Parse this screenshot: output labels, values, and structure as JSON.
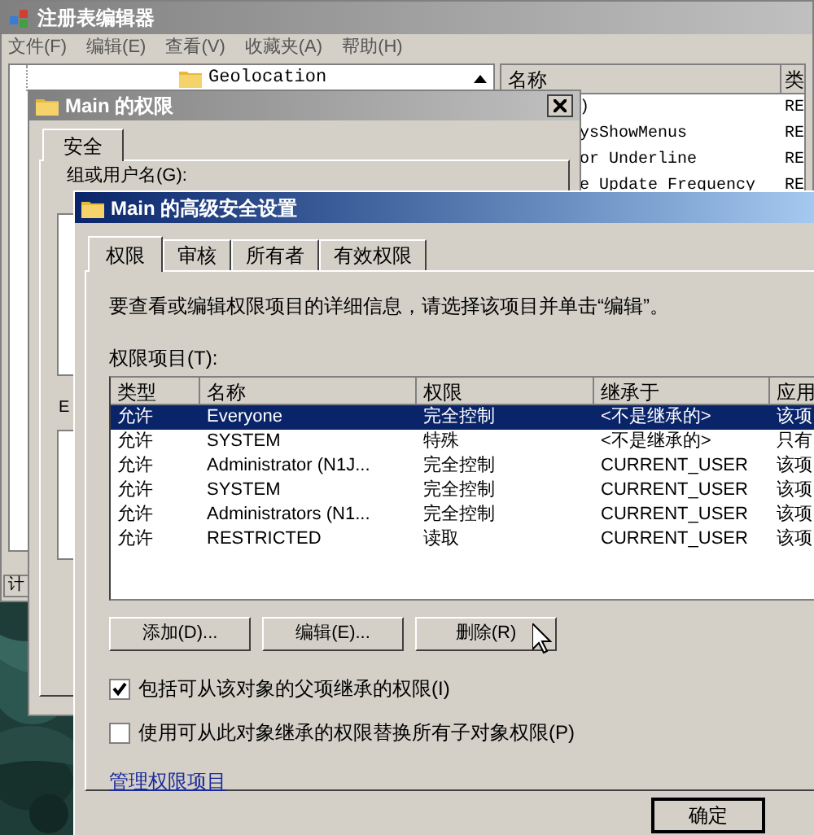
{
  "registry_editor": {
    "title": "注册表编辑器",
    "menu": [
      "文件(F)",
      "编辑(E)",
      "查看(V)",
      "收藏夹(A)",
      "帮助(H)"
    ],
    "tree": [
      {
        "label": "Geolocation"
      }
    ],
    "columns": [
      "名称",
      "类"
    ],
    "values": [
      {
        "name": ")",
        "type": "RE"
      },
      {
        "name": "ysShowMenus",
        "type": "RE"
      },
      {
        "name": "or Underline",
        "type": "RE"
      },
      {
        "name": "e Update Frequency",
        "type": "RE"
      }
    ],
    "status_bar": "计"
  },
  "permissions_dialog": {
    "title": "Main 的权限",
    "tabs": [
      {
        "label": "安全",
        "selected": true
      }
    ],
    "group_label": "组或用户名(G):",
    "partial_label": "E"
  },
  "advanced_dialog": {
    "title": "Main 的高级安全设置",
    "tabs": [
      {
        "label": "权限",
        "selected": true
      },
      {
        "label": "审核",
        "selected": false
      },
      {
        "label": "所有者",
        "selected": false
      },
      {
        "label": "有效权限",
        "selected": false
      }
    ],
    "description": "要查看或编辑权限项目的详细信息，请选择该项目并单击“编辑”。",
    "list_label": "权限项目(T):",
    "columns": [
      "类型",
      "名称",
      "权限",
      "继承于",
      "应用"
    ],
    "rows": [
      {
        "cells": [
          "允许",
          "Everyone",
          "完全控制",
          "<不是继承的>",
          "该项"
        ],
        "selected": true
      },
      {
        "cells": [
          "允许",
          "SYSTEM",
          "特殊",
          "<不是继承的>",
          "只有"
        ],
        "selected": false
      },
      {
        "cells": [
          "允许",
          "Administrator (N1J...",
          "完全控制",
          "CURRENT_USER",
          "该项"
        ],
        "selected": false
      },
      {
        "cells": [
          "允许",
          "SYSTEM",
          "完全控制",
          "CURRENT_USER",
          "该项"
        ],
        "selected": false
      },
      {
        "cells": [
          "允许",
          "Administrators (N1...",
          "完全控制",
          "CURRENT_USER",
          "该项"
        ],
        "selected": false
      },
      {
        "cells": [
          "允许",
          "RESTRICTED",
          "读取",
          "CURRENT_USER",
          "该项"
        ],
        "selected": false
      }
    ],
    "buttons": [
      "添加(D)...",
      "编辑(E)...",
      "删除(R)"
    ],
    "options": [
      {
        "label": "包括可从该对象的父项继承的权限(I)",
        "checked": true
      },
      {
        "label": "使用可从此对象继承的权限替换所有子对象权限(P)",
        "checked": false
      }
    ],
    "link": "管理权限项目",
    "footer_buttons": [
      "确定"
    ]
  }
}
